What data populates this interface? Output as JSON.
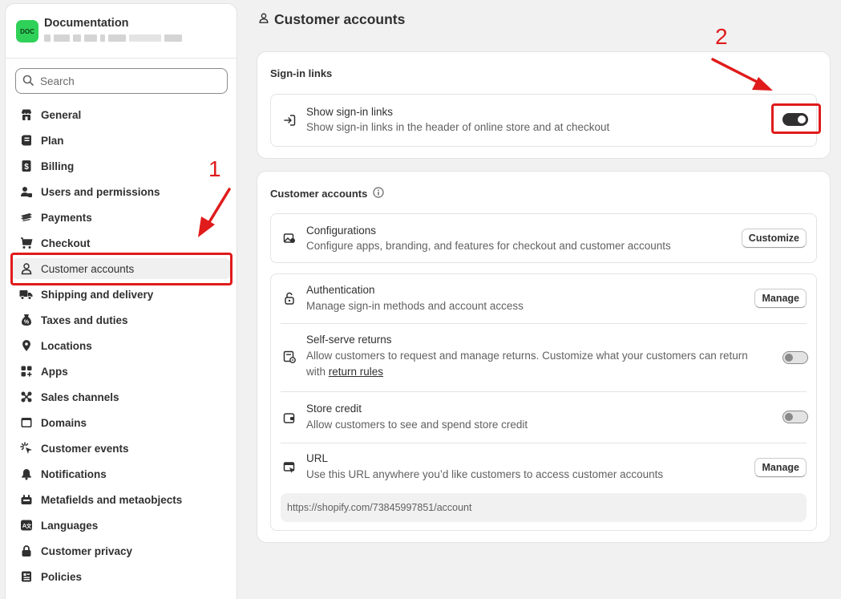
{
  "store": {
    "logo_text": "DOC",
    "name": "Documentation"
  },
  "search": {
    "placeholder": "Search"
  },
  "nav": [
    {
      "label": "General",
      "icon": "store-icon"
    },
    {
      "label": "Plan",
      "icon": "plan-icon"
    },
    {
      "label": "Billing",
      "icon": "billing-icon"
    },
    {
      "label": "Users and permissions",
      "icon": "users-icon"
    },
    {
      "label": "Payments",
      "icon": "payments-icon"
    },
    {
      "label": "Checkout",
      "icon": "cart-icon"
    },
    {
      "label": "Customer accounts",
      "icon": "person-icon",
      "active": true
    },
    {
      "label": "Shipping and delivery",
      "icon": "truck-icon"
    },
    {
      "label": "Taxes and duties",
      "icon": "tax-icon"
    },
    {
      "label": "Locations",
      "icon": "location-icon"
    },
    {
      "label": "Apps",
      "icon": "apps-icon"
    },
    {
      "label": "Sales channels",
      "icon": "channels-icon"
    },
    {
      "label": "Domains",
      "icon": "globe-icon"
    },
    {
      "label": "Customer events",
      "icon": "sparkle-icon"
    },
    {
      "label": "Notifications",
      "icon": "bell-icon"
    },
    {
      "label": "Metafields and metaobjects",
      "icon": "metafields-icon"
    },
    {
      "label": "Languages",
      "icon": "language-icon"
    },
    {
      "label": "Customer privacy",
      "icon": "lock-icon"
    },
    {
      "label": "Policies",
      "icon": "policies-icon"
    }
  ],
  "page": {
    "title": "Customer accounts"
  },
  "signin_card": {
    "title": "Sign-in links",
    "row_title": "Show sign-in links",
    "row_desc": "Show sign-in links in the header of online store and at checkout",
    "toggle_on": true
  },
  "accounts_card": {
    "title": "Customer accounts",
    "config": {
      "title": "Configurations",
      "desc": "Configure apps, branding, and features for checkout and customer accounts",
      "button": "Customize"
    },
    "auth": {
      "title": "Authentication",
      "desc": "Manage sign-in methods and account access",
      "button": "Manage"
    },
    "returns": {
      "title": "Self-serve returns",
      "desc_line1": "Allow customers to request and manage returns. Customize what your customers can return",
      "desc_prefix": "with ",
      "link": "return rules",
      "toggle_on": false
    },
    "credit": {
      "title": "Store credit",
      "desc": "Allow customers to see and spend store credit",
      "toggle_on": false
    },
    "url": {
      "title": "URL",
      "desc": "Use this URL anywhere you’d like customers to access customer accounts",
      "button": "Manage",
      "value": "https://shopify.com/73845997851/account"
    }
  },
  "annotations": {
    "one": "1",
    "two": "2",
    "color": "#e01b1b"
  }
}
